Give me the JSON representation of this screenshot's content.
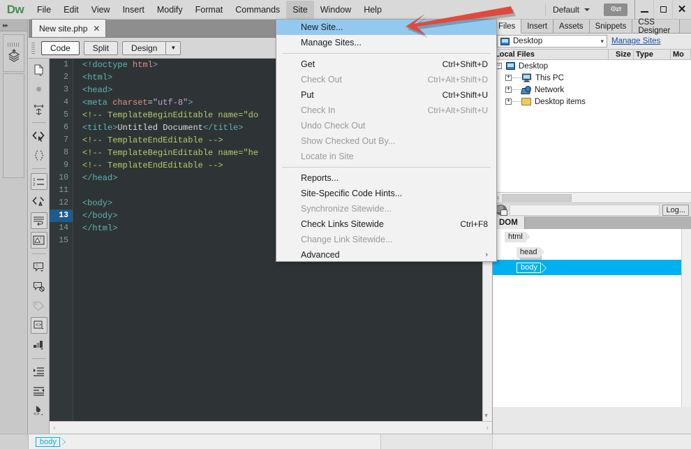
{
  "app": {
    "logo": "Dw",
    "workspace": "Default",
    "sync_icon": "sync-settings-icon"
  },
  "menubar": {
    "items": [
      {
        "label": "File"
      },
      {
        "label": "Edit"
      },
      {
        "label": "View"
      },
      {
        "label": "Insert"
      },
      {
        "label": "Modify"
      },
      {
        "label": "Format"
      },
      {
        "label": "Commands"
      },
      {
        "label": "Site",
        "active": true
      },
      {
        "label": "Window"
      },
      {
        "label": "Help"
      }
    ]
  },
  "window_controls": {
    "minimize": "minimize-icon",
    "maximize": "maximize-icon",
    "close": "✕"
  },
  "document_tabs": [
    {
      "label": "New site.php",
      "close": "✕"
    }
  ],
  "viewbar": {
    "buttons": [
      "Code",
      "Split",
      "Design"
    ],
    "selected": "Code",
    "dropdown_caret": "▼"
  },
  "site_menu": {
    "items": [
      {
        "label": "New Site...",
        "shortcut": "",
        "enabled": true,
        "highlighted": true
      },
      {
        "label": "Manage Sites...",
        "shortcut": "",
        "enabled": true
      },
      {
        "separator": true
      },
      {
        "label": "Get",
        "shortcut": "Ctrl+Shift+D",
        "enabled": true
      },
      {
        "label": "Check Out",
        "shortcut": "Ctrl+Alt+Shift+D",
        "enabled": false
      },
      {
        "label": "Put",
        "shortcut": "Ctrl+Shift+U",
        "enabled": true
      },
      {
        "label": "Check In",
        "shortcut": "Ctrl+Alt+Shift+U",
        "enabled": false
      },
      {
        "label": "Undo Check Out",
        "shortcut": "",
        "enabled": false
      },
      {
        "label": "Show Checked Out By...",
        "shortcut": "",
        "enabled": false
      },
      {
        "label": "Locate in Site",
        "shortcut": "",
        "enabled": false
      },
      {
        "separator": true
      },
      {
        "label": "Reports...",
        "shortcut": "",
        "enabled": true
      },
      {
        "label": "Site-Specific Code Hints...",
        "shortcut": "",
        "enabled": true
      },
      {
        "label": "Synchronize Sitewide...",
        "shortcut": "",
        "enabled": false
      },
      {
        "label": "Check Links Sitewide",
        "shortcut": "Ctrl+F8",
        "enabled": true
      },
      {
        "label": "Change Link Sitewide...",
        "shortcut": "",
        "enabled": false
      },
      {
        "label": "Advanced",
        "submenu": "›",
        "enabled": true
      }
    ]
  },
  "code": {
    "current_line": 13,
    "lines": [
      {
        "n": 1,
        "text": "<!doctype html>"
      },
      {
        "n": 2,
        "text": "<html>"
      },
      {
        "n": 3,
        "text": "<head>"
      },
      {
        "n": 4,
        "text": "<meta charset=\"utf-8\">"
      },
      {
        "n": 5,
        "text": "<!-- TemplateBeginEditable name=\"doc\""
      },
      {
        "n": 6,
        "text": "<title>Untitled Document</title>"
      },
      {
        "n": 7,
        "text": "<!-- TemplateEndEditable -->"
      },
      {
        "n": 8,
        "text": "<!-- TemplateBeginEditable name=\"he"
      },
      {
        "n": 9,
        "text": "<!-- TemplateEndEditable -->"
      },
      {
        "n": 10,
        "text": "</head>"
      },
      {
        "n": 11,
        "text": ""
      },
      {
        "n": 12,
        "text": "<body>"
      },
      {
        "n": 13,
        "text": "</body>"
      },
      {
        "n": 14,
        "text": "</html>"
      },
      {
        "n": 15,
        "text": ""
      }
    ]
  },
  "right_dock": {
    "panel_tabs": [
      {
        "label": "Files",
        "selected": true
      },
      {
        "label": "Insert"
      },
      {
        "label": "Assets"
      },
      {
        "label": "Snippets"
      },
      {
        "label": "CSS Designer"
      }
    ],
    "site_combo": {
      "value": "Desktop",
      "icon": "desktop-icon"
    },
    "manage_sites_link": "Manage Sites",
    "file_columns": [
      "Local Files",
      "Size",
      "Type",
      "Mo"
    ],
    "file_rows": [
      {
        "name": "Desktop",
        "indent": 0,
        "expander": "−",
        "icon": "desktop-icon"
      },
      {
        "name": "This PC",
        "indent": 1,
        "expander": "+",
        "icon": "computer-icon"
      },
      {
        "name": "Network",
        "indent": 1,
        "expander": "+",
        "icon": "network-icon"
      },
      {
        "name": "Desktop items",
        "indent": 1,
        "expander": "+",
        "icon": "folder-icon"
      }
    ],
    "log_button": "Log...",
    "dom_tab": "DOM",
    "dom_nodes": [
      {
        "label": "html",
        "indent": 0,
        "selected": false,
        "stacked": false
      },
      {
        "label": "head",
        "indent": 1,
        "selected": false,
        "stacked": true
      },
      {
        "label": "body",
        "indent": 1,
        "selected": true,
        "stacked": false
      }
    ]
  },
  "statusbar": {
    "tag_selector": "body"
  },
  "annotation": {
    "arrow_color": "#e04a3c",
    "points_to": "New Site..."
  },
  "icon_rail": {
    "icons": [
      "new-document-icon",
      "format-source-icon",
      "wrap-lines-icon",
      "code-view-icon",
      "braces-icon",
      "line-numbers-icon",
      "highlight-invalid-icon",
      "word-wrap-icon",
      "syntax-colors-icon",
      "apply-comment-icon",
      "remove-comment-icon",
      "highlight-tag-icon",
      "recent-snippets-icon",
      "collapse-group-icon",
      "indent-code-icon",
      "outdent-code-icon",
      "format-code-icon"
    ]
  }
}
